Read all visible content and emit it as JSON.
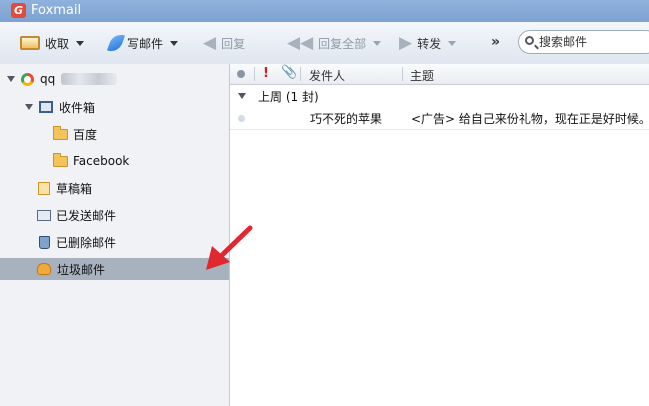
{
  "window": {
    "title": "Foxmail",
    "logo_letter": "G"
  },
  "toolbar": {
    "receive_label": "收取",
    "compose_label": "写邮件",
    "reply_label": "回复",
    "reply_all_label": "回复全部",
    "forward_label": "转发",
    "more_label": "»"
  },
  "search": {
    "placeholder": "搜索邮件"
  },
  "sidebar": {
    "account_name": "qq",
    "items": [
      {
        "label": "收件箱"
      },
      {
        "label": "百度"
      },
      {
        "label": "Facebook"
      },
      {
        "label": "草稿箱"
      },
      {
        "label": "已发送邮件"
      },
      {
        "label": "已删除邮件"
      },
      {
        "label": "垃圾邮件",
        "selected": true
      }
    ]
  },
  "mail_list": {
    "columns": {
      "flag": "!",
      "attachment": "📎",
      "sender": "发件人",
      "subject": "主题"
    },
    "group_label": "上周 (1 封)",
    "rows": [
      {
        "sender": "巧不死的苹果",
        "subject": "<广告> 给自己来份礼物，现在正是好时候。"
      }
    ]
  },
  "colors": {
    "annotation_arrow": "#e0282f",
    "selected_item": "#a8b2bf"
  }
}
